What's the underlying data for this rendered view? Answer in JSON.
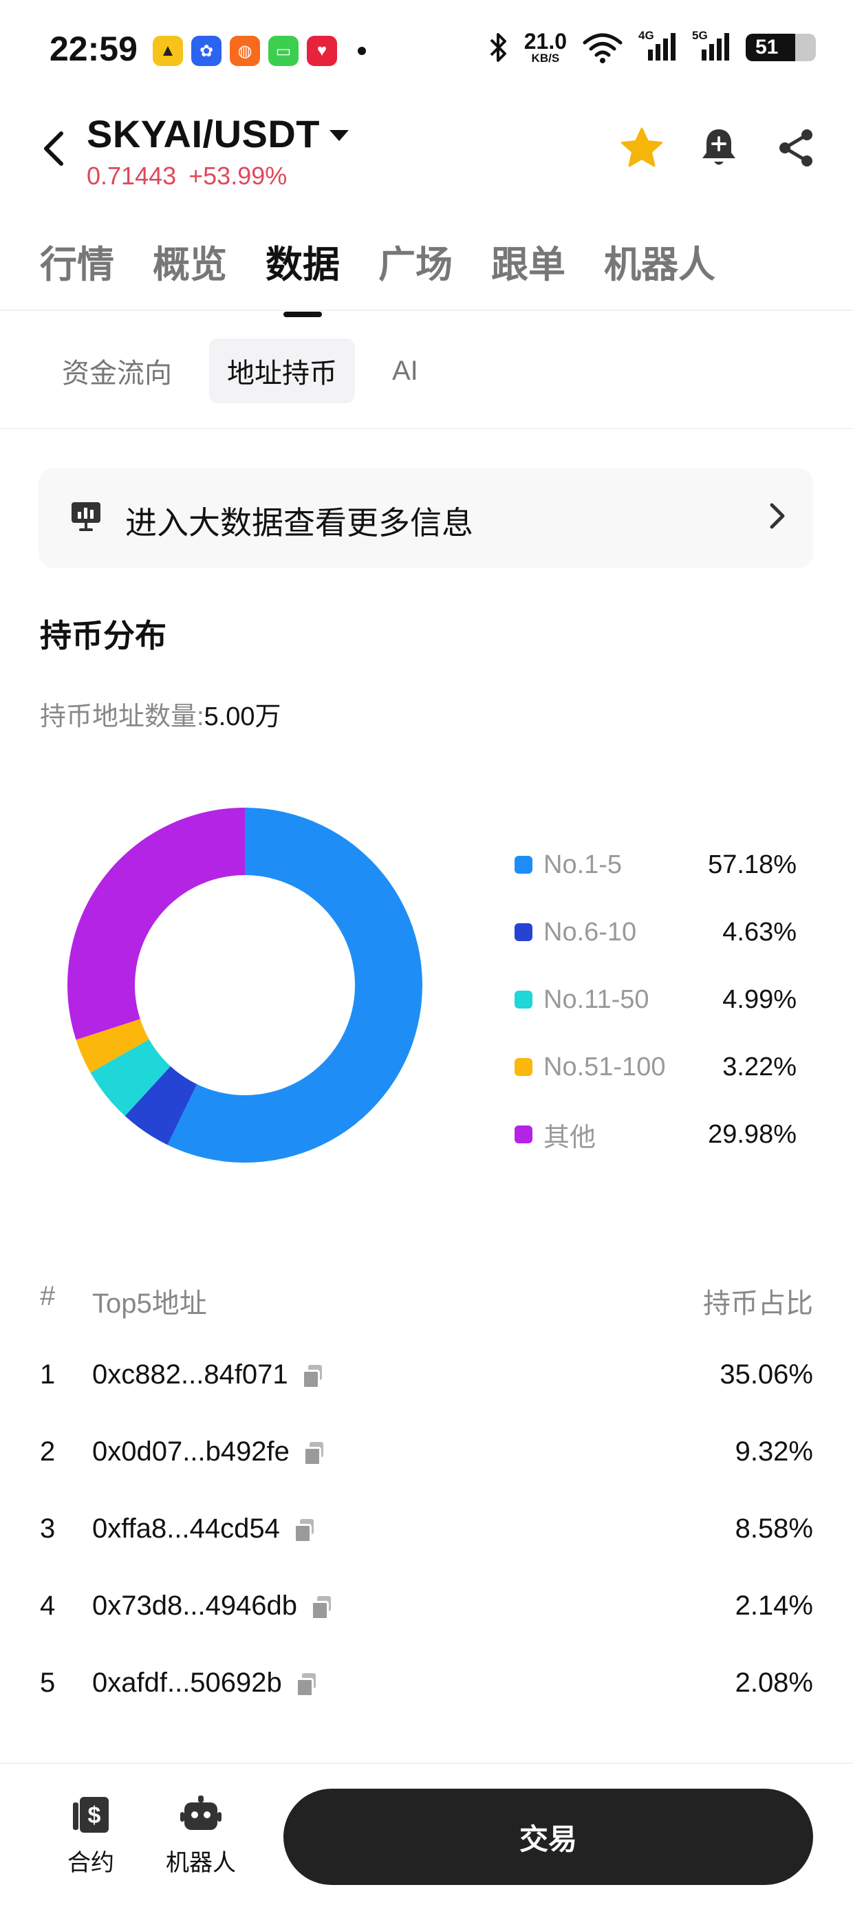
{
  "status_bar": {
    "time": "22:59",
    "net_speed": "21.0",
    "net_speed_unit": "KB/S",
    "net_4g": "4G",
    "net_5g": "5G",
    "battery": "51"
  },
  "header": {
    "pair": "SKYAI/USDT",
    "price": "0.71443",
    "change": "+53.99%",
    "price_color": "#e0475b"
  },
  "main_tabs": [
    "行情",
    "概览",
    "数据",
    "广场",
    "跟单",
    "机器人"
  ],
  "active_main_tab": "数据",
  "sub_tabs": [
    "资金流向",
    "地址持币",
    "AI"
  ],
  "active_sub_tab": "地址持币",
  "banner": {
    "text": "进入大数据查看更多信息"
  },
  "distribution": {
    "title": "持币分布",
    "holders_label": "持币地址数量:",
    "holders_value": "5.00万"
  },
  "chart_data": {
    "type": "pie",
    "categories": [
      "No.1-5",
      "No.6-10",
      "No.11-50",
      "No.51-100",
      "其他"
    ],
    "values": [
      57.18,
      4.63,
      4.99,
      3.22,
      29.98
    ],
    "labels": [
      "57.18%",
      "4.63%",
      "4.99%",
      "3.22%",
      "29.98%"
    ],
    "colors": [
      "#1e8ef6",
      "#2544d4",
      "#1fd6d8",
      "#fbb70b",
      "#b424e4"
    ],
    "legend": "right"
  },
  "table": {
    "headers": {
      "index": "#",
      "address": "Top5地址",
      "percent": "持币占比"
    },
    "rows": [
      {
        "index": "1",
        "address": "0xc882...84f071",
        "percent": "35.06%"
      },
      {
        "index": "2",
        "address": "0x0d07...b492fe",
        "percent": "9.32%"
      },
      {
        "index": "3",
        "address": "0xffa8...44cd54",
        "percent": "8.58%"
      },
      {
        "index": "4",
        "address": "0x73d8...4946db",
        "percent": "2.14%"
      },
      {
        "index": "5",
        "address": "0xafdf...50692b",
        "percent": "2.08%"
      }
    ]
  },
  "bottom_bar": {
    "contract_label": "合约",
    "robot_label": "机器人",
    "trade_label": "交易"
  }
}
